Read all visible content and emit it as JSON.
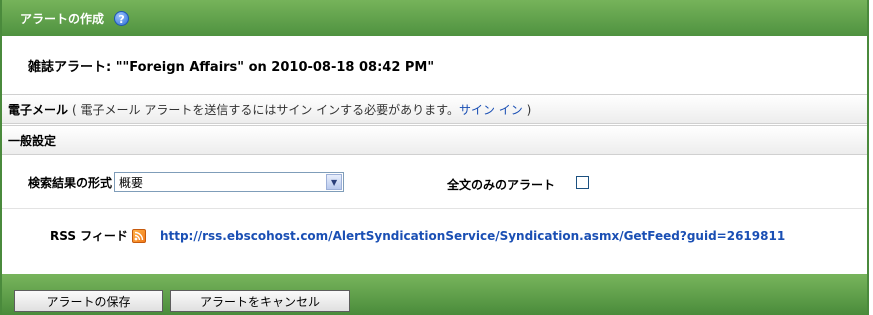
{
  "header": {
    "title": "アラートの作成",
    "help_icon": "?"
  },
  "alert": {
    "title": "雑誌アラート: \"\"Foreign Affairs\" on 2010-08-18 08:42 PM\""
  },
  "email_section": {
    "label": "電子メール",
    "note_open": "( 電子メール アラートを送信するにはサイン インする必要があります。",
    "signin_link": "サイン イン",
    "note_close": " )"
  },
  "general_section": {
    "label": "一般設定"
  },
  "format": {
    "label": "検索結果の形式",
    "selected": "概要"
  },
  "fulltext": {
    "label": "全文のみのアラート",
    "checked": false
  },
  "rss": {
    "label": "RSS フィード",
    "url": "http://rss.ebscohost.com/AlertSyndicationService/Syndication.asmx/GetFeed?guid=2619811"
  },
  "buttons": {
    "save": "アラートの保存",
    "cancel": "アラートをキャンセル"
  },
  "colors": {
    "header_green": "#5a9b46",
    "link_blue": "#1a4fb4",
    "rss_orange": "#f27a1a"
  }
}
